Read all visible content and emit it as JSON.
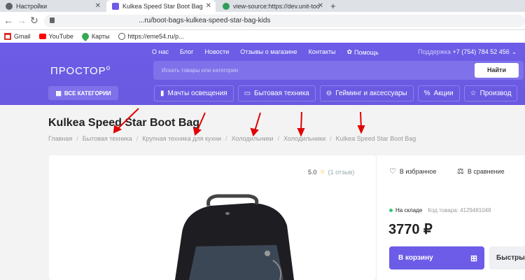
{
  "browser": {
    "tabs": [
      {
        "title": "Настройки"
      },
      {
        "title": "Kulkea Speed Star Boot Bag"
      },
      {
        "title": "view-source:https://dev.unit-too"
      }
    ],
    "address": {
      "visible_url": "...ru/boot-bags-kulkea-speed-star-bag-kids"
    },
    "bookmarks": [
      {
        "label": "Gmail",
        "icon": "gmail-icon"
      },
      {
        "label": "YouTube",
        "icon": "youtube-icon"
      },
      {
        "label": "Карты",
        "icon": "maps-icon"
      },
      {
        "label": "https://eme54.ru/p...",
        "icon": "globe-icon"
      }
    ]
  },
  "site": {
    "top_nav": [
      "О нас",
      "Блог",
      "Новости",
      "Отзывы о магазине",
      "Контакты"
    ],
    "help": "Помощь",
    "support_label": "Поддержка",
    "phone": "+7 (754) 784 52 456",
    "logo": "ПРОСТОР",
    "search": {
      "placeholder": "Искать товары или категории",
      "button": "Найти"
    },
    "all_categories": "ВСЕ КАТЕГОРИИ",
    "categories": [
      {
        "label": "Мачты освещения",
        "icon": "tower-icon"
      },
      {
        "label": "Бытовая техника",
        "icon": "monitor-icon"
      },
      {
        "label": "Гейминг и аксессуары",
        "icon": "gamepad-icon"
      },
      {
        "label": "Акции",
        "icon": "percent-icon"
      },
      {
        "label": "Производ",
        "icon": "star-icon"
      }
    ]
  },
  "product": {
    "title": "Kulkea Speed Star Boot Bag",
    "breadcrumbs": [
      "Главная",
      "Бытовая техника",
      "Крупная техника для кухни",
      "Холодильники",
      "Холодильники",
      "Kulkea Speed Star Boot Bag"
    ],
    "rating": "5.0",
    "reviews": "(1 отзыв)",
    "favorite": "В избранное",
    "compare": "В сравнение",
    "stock": "На складе",
    "code": "Код товара: 4129481048",
    "price": "3770 ₽",
    "cart_button": "В корзину",
    "quick_buy": "Быстры"
  },
  "colors": {
    "brand": "#6c5ce7",
    "annotation": "#e00000",
    "in_stock": "#2ecc71"
  }
}
